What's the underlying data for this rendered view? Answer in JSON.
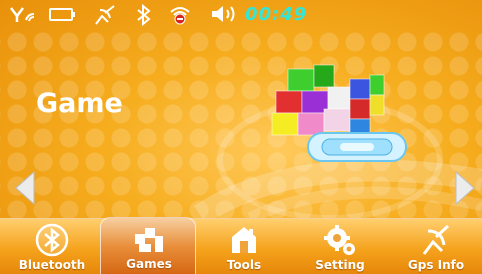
{
  "status_bar": {
    "clock": "00:49",
    "icons": [
      "gps-signal-icon",
      "battery-icon",
      "satellite-icon",
      "bluetooth-icon",
      "wifi-disabled-icon",
      "volume-icon"
    ]
  },
  "main": {
    "title": "Game"
  },
  "dock": {
    "items": [
      {
        "label": "Bluetooth",
        "icon": "bluetooth-icon"
      },
      {
        "label": "Games",
        "icon": "games-icon",
        "active": true
      },
      {
        "label": "Tools",
        "icon": "tools-icon"
      },
      {
        "label": "Setting",
        "icon": "gear-icon"
      },
      {
        "label": "Gps Info",
        "icon": "satellite-icon"
      }
    ]
  },
  "colors": {
    "background": "#f6ad1e",
    "clock": "#33e6d8",
    "active_tab": "#e98e3a"
  }
}
